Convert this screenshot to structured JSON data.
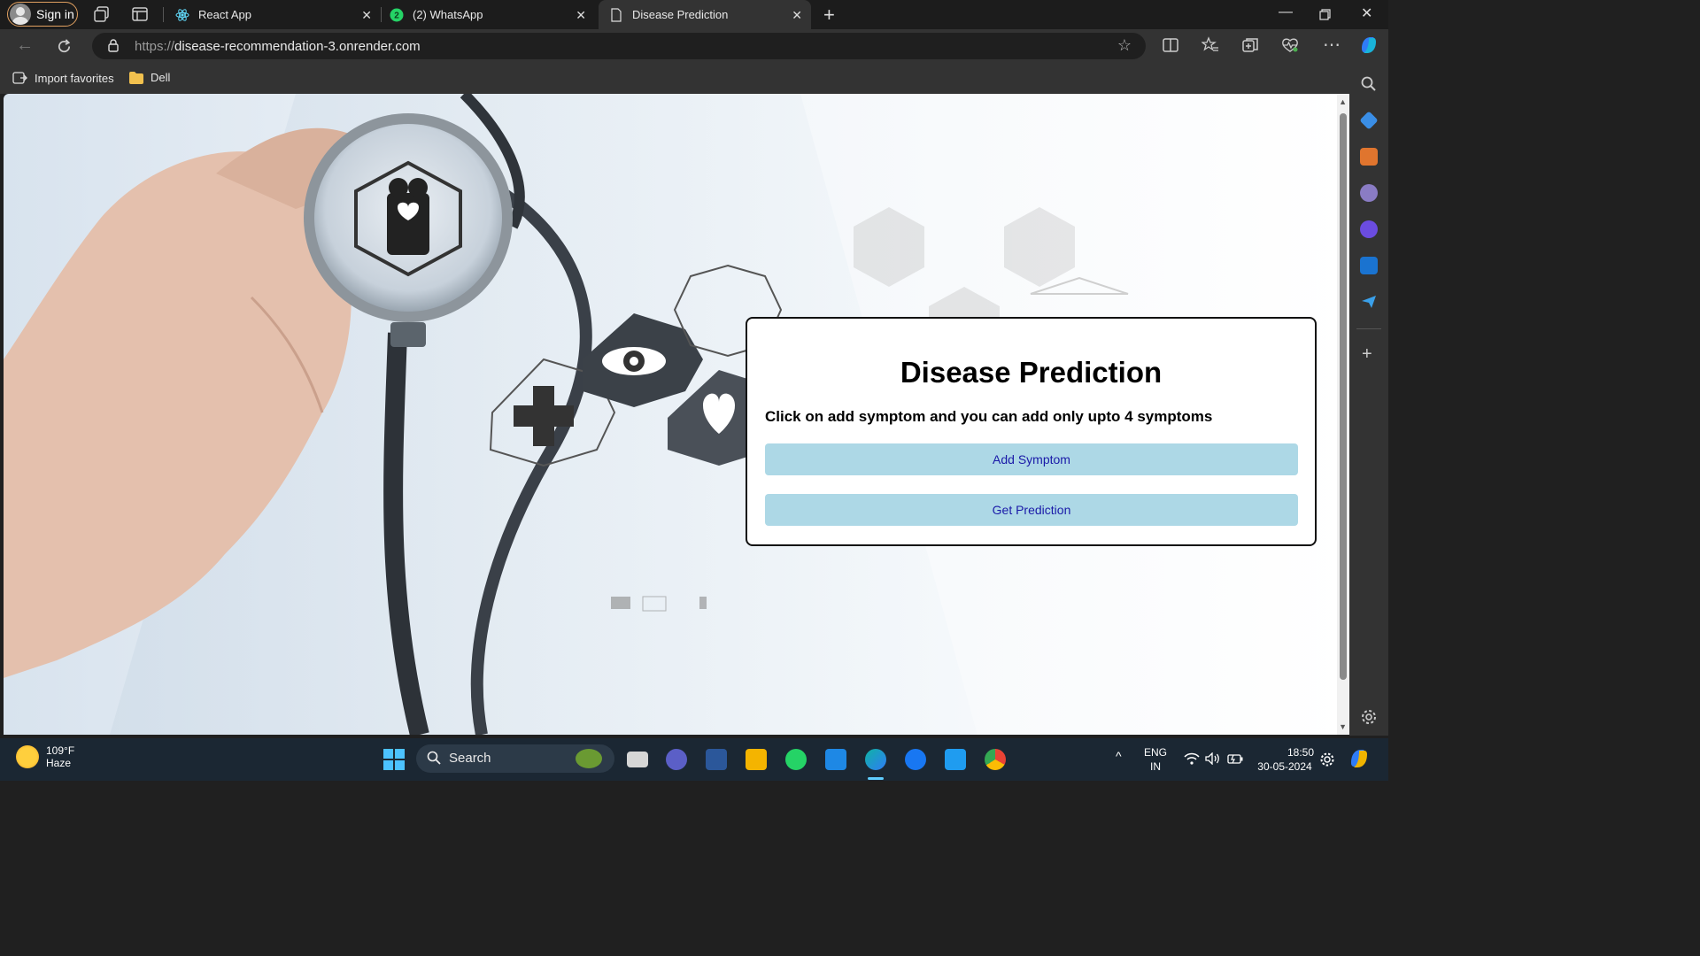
{
  "browser": {
    "signin_label": "Sign in",
    "tabs": [
      {
        "title": "React App"
      },
      {
        "title": "(2) WhatsApp",
        "badge": "2"
      },
      {
        "title": "Disease Prediction"
      }
    ],
    "url_protocol": "https://",
    "url_host": "disease-recommendation-3.onrender.com",
    "favorites": [
      {
        "label": "Import favorites"
      },
      {
        "label": "Dell"
      }
    ]
  },
  "page": {
    "title": "Disease Prediction",
    "instruction": "Click on add symptom and you can add only upto 4 symptoms",
    "add_symptom_label": "Add Symptom",
    "get_prediction_label": "Get Prediction",
    "button_color": "#add8e6",
    "button_text_color": "#1a1aa8"
  },
  "taskbar": {
    "temperature": "109°F",
    "condition": "Haze",
    "search_placeholder": "Search",
    "language": "ENG",
    "region": "IN",
    "time": "18:50",
    "date": "30-05-2024"
  }
}
